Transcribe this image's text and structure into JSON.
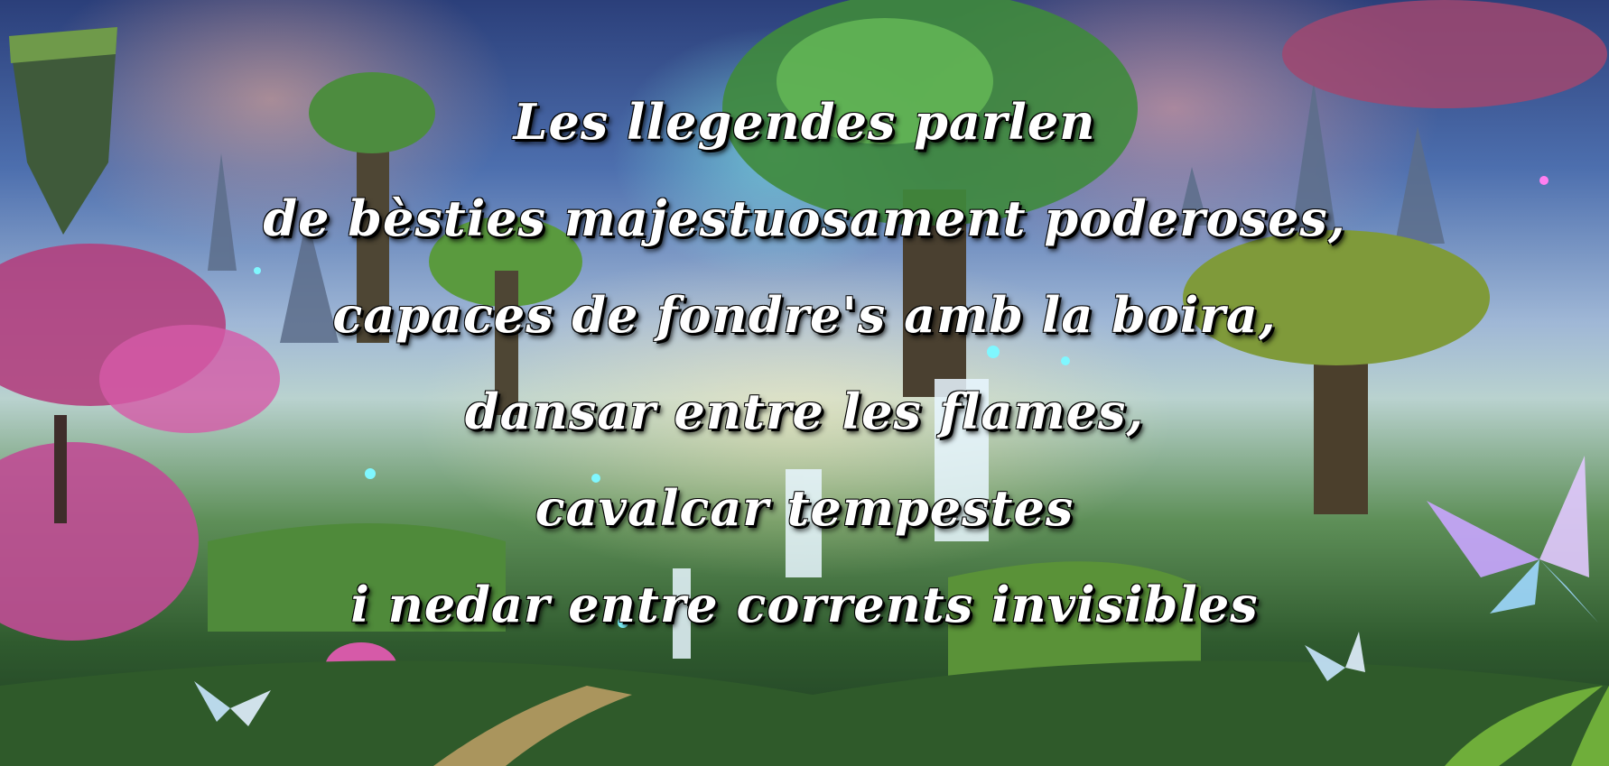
{
  "poem": {
    "lines": [
      "Les llegendes parlen",
      "de bèsties majestuosament poderoses,",
      "capaces de fondre's amb la boira,",
      "dansar entre les flames,",
      "cavalcar tempestes",
      "i nedar entre corrents invisibles"
    ]
  },
  "colors": {
    "text": "#ffffff",
    "text_outline": "#000000",
    "sky_top": "#2b3f7a",
    "glow_cyan": "#8cfff0",
    "cloud_pink": "#ffaaa0",
    "foliage_green": "#5e8f58",
    "blossom_pink": "#d65aa8",
    "butterfly_glow": "#c9a6ff"
  },
  "illustration": {
    "elements": [
      "floating-islands",
      "giant-trees",
      "waterfalls",
      "pink-blossom-trees",
      "glowing-butterflies",
      "spirit-lights",
      "rock-spires"
    ]
  }
}
